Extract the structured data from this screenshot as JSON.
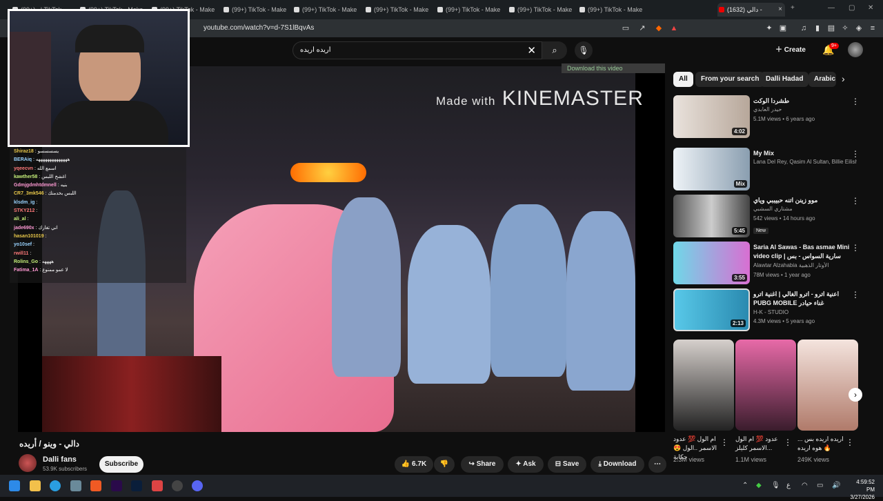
{
  "browser": {
    "tabs": [
      "(99+) ‎ ‎ | TikTok",
      "(99+) TikTok - Make",
      "(99+) TikTok - Make",
      "(99+) TikTok - Make",
      "(99+) TikTok - Make",
      "(99+) TikTok - Make",
      "(99+) TikTok - Make",
      "(99+) TikTok - Make",
      "(99+) TikTok - Make",
      "(1632) دالي -"
    ],
    "active_tab_close": "×",
    "new_tab": "+",
    "url": "youtube.com/watch?v=d-7S1lBqvAs",
    "min": "—",
    "max": "▢",
    "close": "✕"
  },
  "youtube": {
    "search_query": "اريده اريده",
    "create_label": "Create",
    "notif_count": "9+",
    "download_ext": "Download this video"
  },
  "video": {
    "watermark_small": "Made with",
    "watermark_big": "KINEMASTER",
    "title": "دالي - وينو / أريده",
    "channel": "Dalli fans",
    "subscribers": "53.9K subscribers",
    "subscribe": "Subscribe",
    "likes": "6.7K",
    "share": "Share",
    "ask": "Ask",
    "save": "Save",
    "download": "Download"
  },
  "chat": [
    {
      "n": "Shiraz18",
      "m": "يسسسسو"
    },
    {
      "n": "BERAiq",
      "m": "ههههههههههههههه"
    },
    {
      "n": "yqeecvn",
      "m": "اسمع الله"
    },
    {
      "n": "kawther58",
      "m": "اغشخ اللبس"
    },
    {
      "n": "Gdmjgdmhtdmnell",
      "m": "بنيه"
    },
    {
      "n": "CR7_3mk546",
      "m": "اللبس بخدمتك"
    },
    {
      "n": "klsdm_ig",
      "m": ""
    },
    {
      "n": "STKY212",
      "m": ""
    },
    {
      "n": "ali_al",
      "m": ""
    },
    {
      "n": "jade690x",
      "m": "اني تغارك"
    },
    {
      "n": "hasan101019",
      "m": ""
    },
    {
      "n": "yo10sef",
      "m": ""
    },
    {
      "n": "rwill11",
      "m": ""
    },
    {
      "n": "Rolins_Go",
      "m": "ههههه"
    },
    {
      "n": "Fatima_1A",
      "m": "لا عمو ممنوع"
    }
  ],
  "filters": [
    "All",
    "From your search",
    "Dalli Hadad",
    "Arabic"
  ],
  "recs": [
    {
      "title": "طشردا الوكت",
      "channel": "حيدر العابدي",
      "meta": "5.1M views • 6 years ago",
      "dur": "4:02"
    },
    {
      "title": "My Mix",
      "channel": "Lana Del Rey, Qasim Al Sultan, Billie Eilish...",
      "meta": "",
      "dur": "Mix"
    },
    {
      "title": "موو زينن اتنه حبيببي وياي",
      "channel": "مشتاري السشبي",
      "meta": "542 views • 14 hours ago",
      "dur": "5:45",
      "badge": "New"
    },
    {
      "title": "Saria Al Sawas - Bas asmae Mini video clip | سارية السواس - بس",
      "channel": "Alawtar Alzahabia الأوتار الذهبية",
      "meta": "78M views • 1 year ago",
      "dur": "3:55"
    },
    {
      "title": "اعنية اترو - اترو الغالي | اغنية اترو PUBG MOBILE غناء حيادر",
      "channel": "H-K - STUDIO",
      "meta": "4.3M views • 5 years ago",
      "dur": "2:13"
    }
  ],
  "shorts": [
    {
      "title": "ام الول 💯 عدود الاسمر ..الول 😍 حكاية",
      "views": "2.3M views"
    },
    {
      "title": "عدود 💯 ام الول ...الاسمر كليلز",
      "views": "1.1M views"
    },
    {
      "title": "اريده اريده بس ... 🔥 هوه اريده",
      "views": "249K views"
    }
  ],
  "clock": {
    "time": "4:59:52 PM",
    "date": "3/27/2026"
  },
  "tray_lang": "ع"
}
